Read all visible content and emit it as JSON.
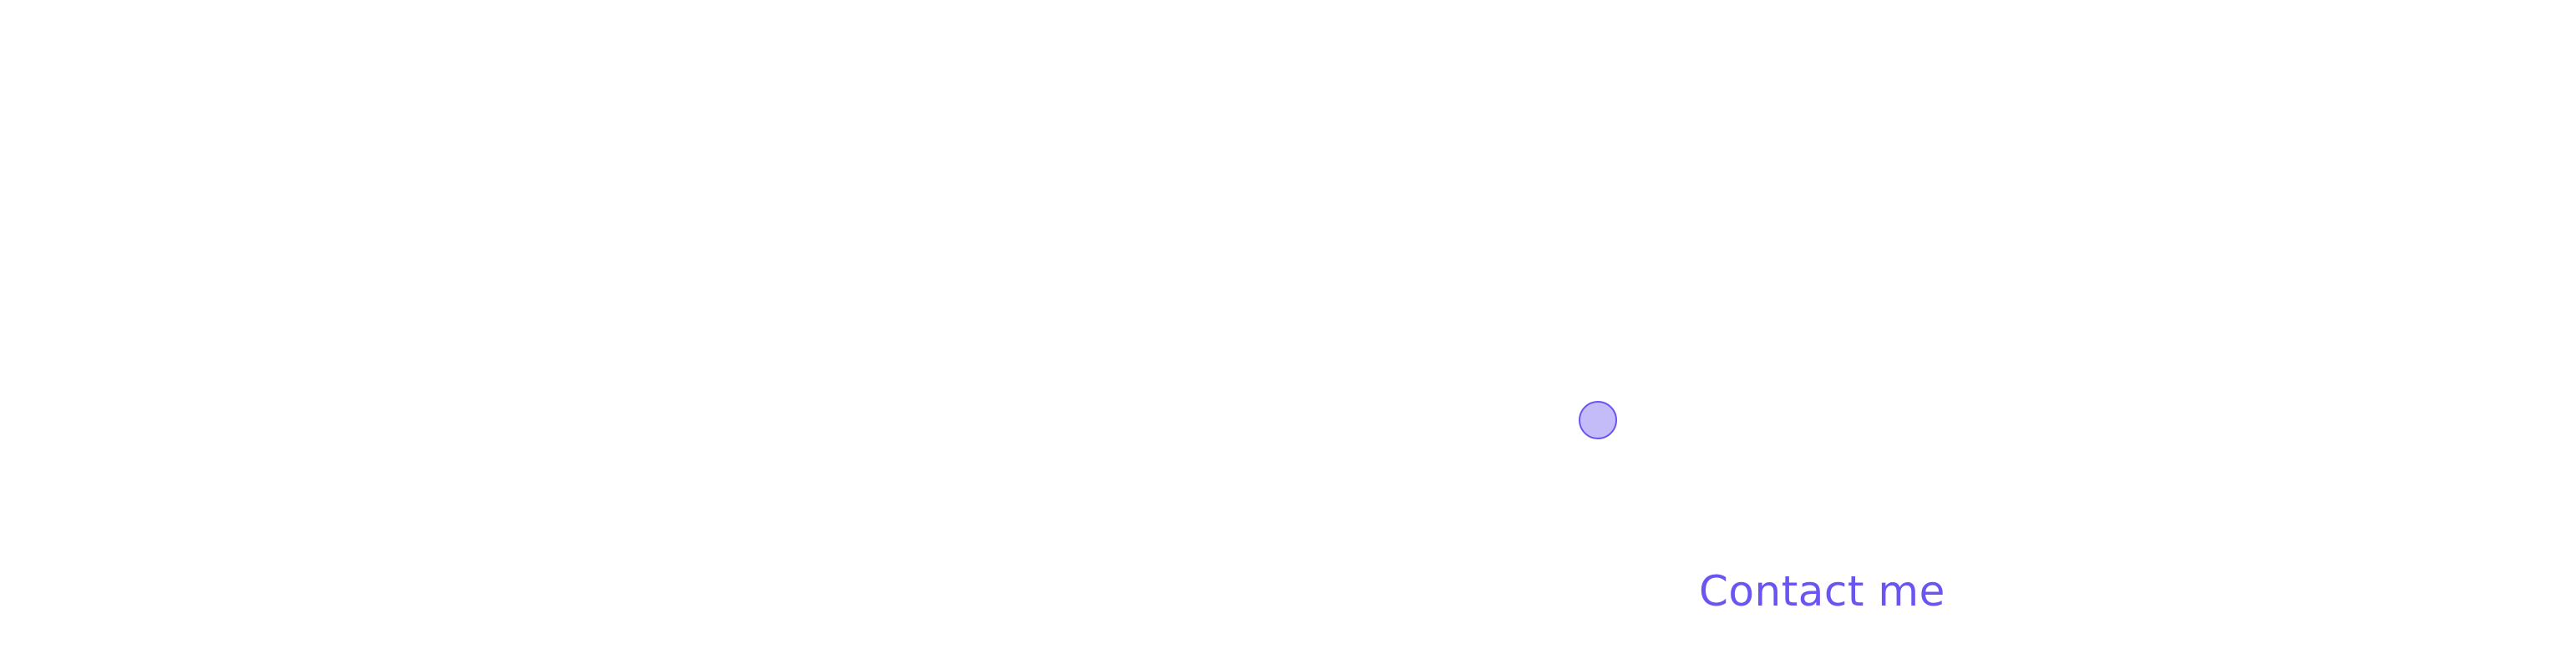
{
  "nav": {
    "contact_label": "Contact me"
  },
  "colors": {
    "accent": "#6a55f3",
    "dot_fill": "#c4bcf9",
    "background": "#ffffff"
  }
}
